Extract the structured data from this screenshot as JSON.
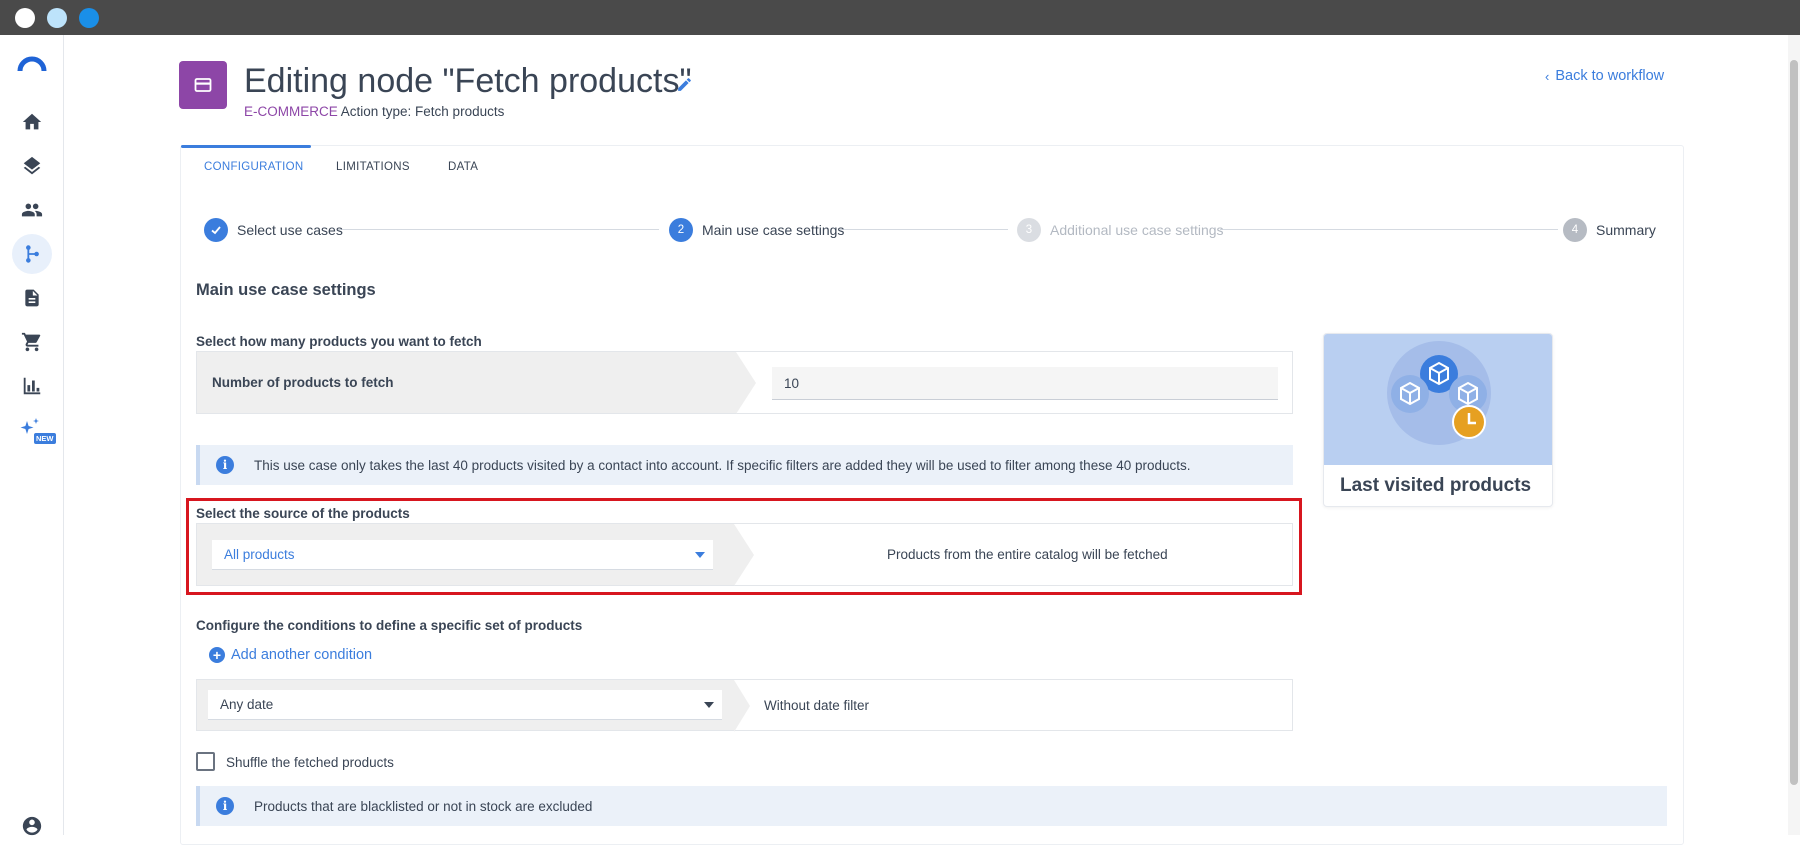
{
  "window": {
    "dot_colors": [
      "#ffffff",
      "#bde3fb",
      "#1a8fe8"
    ]
  },
  "sidebar": {
    "logo": "brand-logo",
    "items": [
      {
        "icon": "home-icon",
        "active": false
      },
      {
        "icon": "layers-icon",
        "active": false
      },
      {
        "icon": "people-icon",
        "active": false
      },
      {
        "icon": "workflow-icon",
        "active": true
      },
      {
        "icon": "document-icon",
        "active": false
      },
      {
        "icon": "cart-icon",
        "active": false
      },
      {
        "icon": "bar-chart-icon",
        "active": false
      },
      {
        "icon": "sparkle-icon",
        "badge": "NEW",
        "active": false
      }
    ],
    "account_icon": "account-icon"
  },
  "header": {
    "title": "Editing node \"Fetch products\"",
    "category": "E-COMMERCE",
    "action_type": " Action type: Fetch products",
    "back_label": "Back to workflow"
  },
  "tabs": [
    {
      "label": "CONFIGURATION",
      "active": true
    },
    {
      "label": "LIMITATIONS",
      "active": false
    },
    {
      "label": "DATA",
      "active": false
    }
  ],
  "stepper": [
    {
      "label": "Select use cases",
      "number": "",
      "state": "done"
    },
    {
      "label": "Main use case settings",
      "number": "2",
      "state": "active"
    },
    {
      "label": "Additional use case settings",
      "number": "3",
      "state": "disabled"
    },
    {
      "label": "Summary",
      "number": "4",
      "state": "inactive"
    }
  ],
  "main": {
    "section_title": "Main use case settings",
    "count_prompt": "Select how many products you want to fetch",
    "count_label": "Number of products to fetch",
    "count_value": "10",
    "info_text": "This use case only takes the last 40 products visited by a contact into account. If specific filters are added they will be used to filter among these 40 products.",
    "source_prompt": "Select the source of the products",
    "source_value": "All products",
    "source_description": "Products from the entire catalog will be fetched",
    "conditions_prompt": "Configure the conditions to define a specific set of products",
    "add_condition_label": "Add another condition",
    "date_value": "Any date",
    "date_description": "Without date filter",
    "shuffle_label": "Shuffle the fetched products",
    "shuffle_checked": false,
    "exclusion_text": "Products that are blacklisted or not in stock are excluded"
  },
  "usecase_card": {
    "title": "Last visited products"
  },
  "colors": {
    "accent": "#3b7ddd",
    "category": "#8d46a7",
    "highlight": "#d7161f",
    "clock": "#e6a021"
  }
}
